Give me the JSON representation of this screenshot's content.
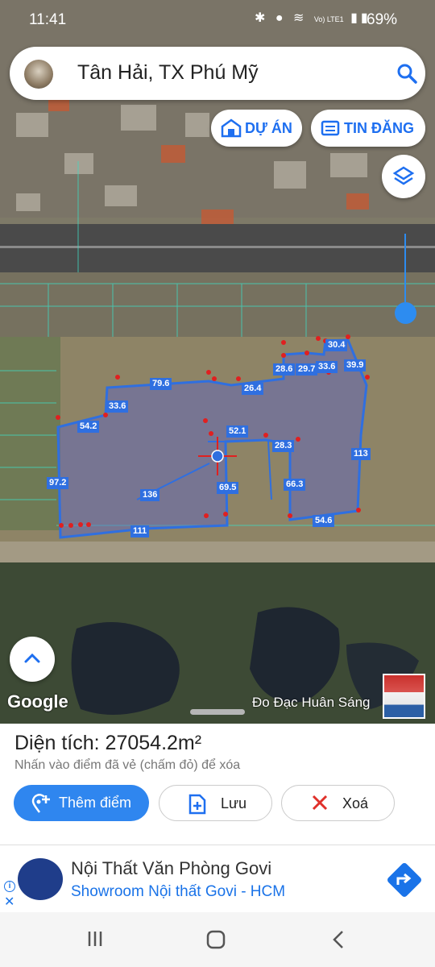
{
  "status_bar": {
    "time": "11:41",
    "battery": "69%",
    "network": "Vo) LTE1"
  },
  "search": {
    "title": "Tân Hải, TX Phú Mỹ"
  },
  "chips": {
    "du_an": "DỰ ÁN",
    "tin_dang": "TIN ĐĂNG"
  },
  "map": {
    "google": "Google",
    "attribution": "Đo Đạc Huân Sáng",
    "edge_labels": [
      "30.4",
      "28.6",
      "29.7",
      "33.6",
      "39.9",
      "79.6",
      "26.4",
      "33.6",
      "54.2",
      "52.1",
      "28.3",
      "113",
      "97.2",
      "136",
      "69.5",
      "66.3",
      "54.6",
      "111"
    ]
  },
  "panel": {
    "area": "Diện tích: 27054.2m²",
    "hint": "Nhấn vào điểm đã vẻ (chấm đỏ) để xóa",
    "add_label": "Thêm điểm",
    "save_label": "Lưu",
    "delete_label": "Xoá"
  },
  "ad": {
    "title": "Nội Thất Văn Phòng Govi",
    "subtitle": "Showroom Nội thất Govi - HCM"
  },
  "colors": {
    "accent": "#2f86ef",
    "polygon": "#2f6fe0",
    "vertex": "#e02020"
  }
}
